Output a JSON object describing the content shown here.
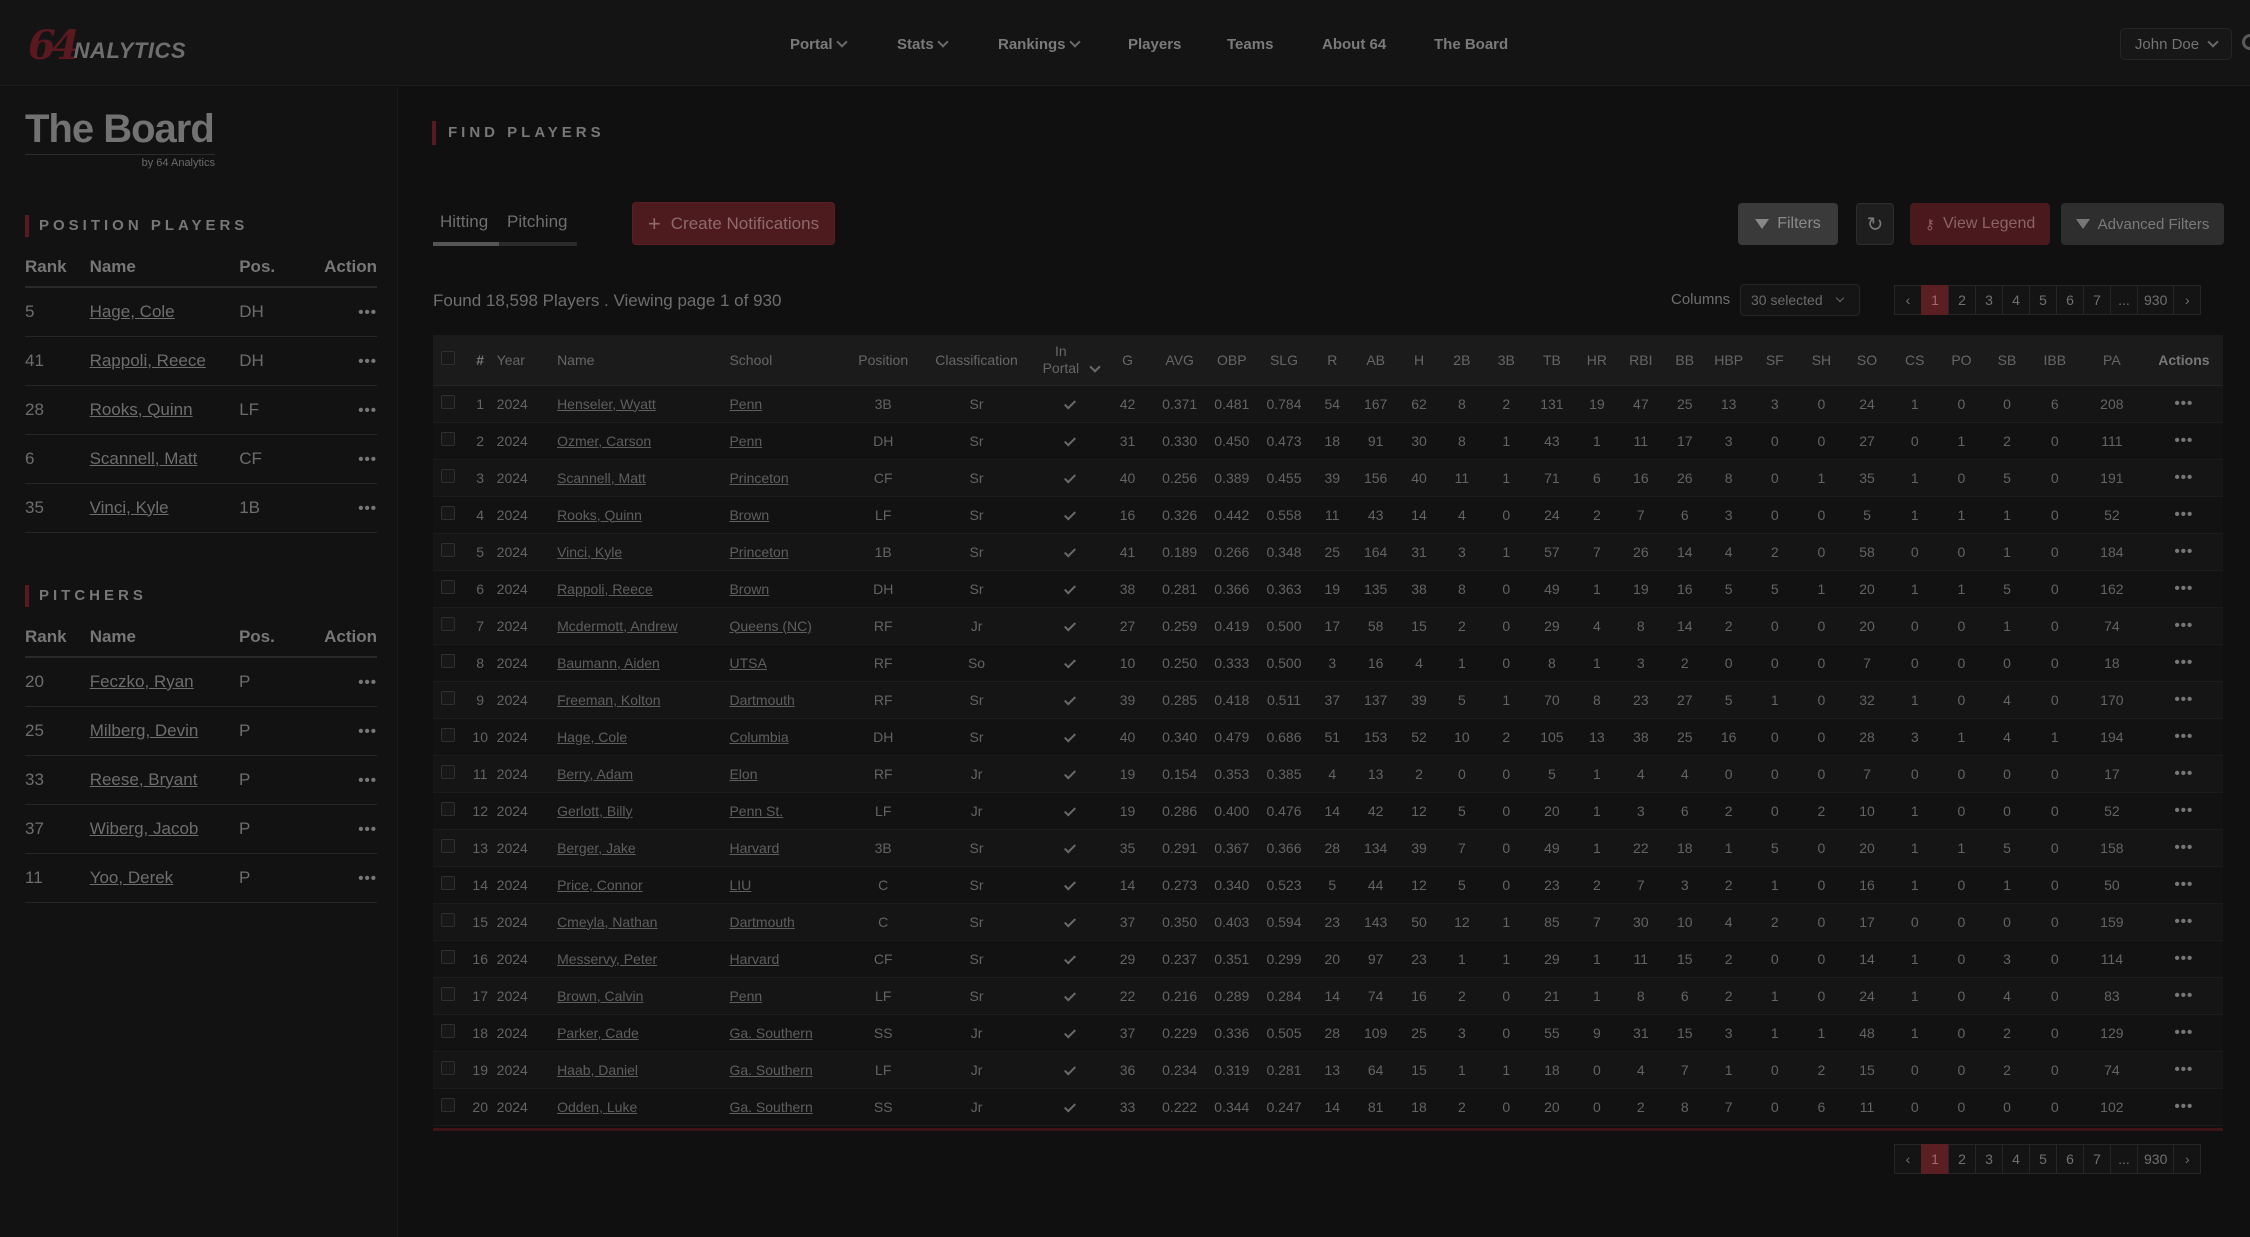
{
  "header": {
    "logo_number": "64",
    "logo_text": "NALYTICS",
    "nav": [
      {
        "label": "Portal",
        "dropdown": true
      },
      {
        "label": "Stats",
        "dropdown": true
      },
      {
        "label": "Rankings",
        "dropdown": true
      },
      {
        "label": "Players",
        "dropdown": false
      },
      {
        "label": "Teams",
        "dropdown": false
      },
      {
        "label": "About 64",
        "dropdown": false
      },
      {
        "label": "The Board",
        "dropdown": false
      }
    ],
    "user_name": "John Doe"
  },
  "sidebar": {
    "title": "The Board",
    "subtitle": "by 64 Analytics",
    "position_players": {
      "heading": "POSITION PLAYERS",
      "columns": [
        "Rank",
        "Name",
        "Pos.",
        "Action"
      ],
      "rows": [
        {
          "rank": "5",
          "name": "Hage, Cole",
          "pos": "DH"
        },
        {
          "rank": "41",
          "name": "Rappoli, Reece",
          "pos": "DH"
        },
        {
          "rank": "28",
          "name": "Rooks, Quinn",
          "pos": "LF"
        },
        {
          "rank": "6",
          "name": "Scannell, Matt",
          "pos": "CF"
        },
        {
          "rank": "35",
          "name": "Vinci, Kyle",
          "pos": "1B"
        }
      ]
    },
    "pitchers": {
      "heading": "PITCHERS",
      "columns": [
        "Rank",
        "Name",
        "Pos.",
        "Action"
      ],
      "rows": [
        {
          "rank": "20",
          "name": "Feczko, Ryan",
          "pos": "P"
        },
        {
          "rank": "25",
          "name": "Milberg, Devin",
          "pos": "P"
        },
        {
          "rank": "33",
          "name": "Reese, Bryant",
          "pos": "P"
        },
        {
          "rank": "37",
          "name": "Wiberg, Jacob",
          "pos": "P"
        },
        {
          "rank": "11",
          "name": "Yoo, Derek",
          "pos": "P"
        }
      ]
    }
  },
  "main": {
    "section_title": "FIND PLAYERS",
    "tabs": [
      {
        "label": "Hitting",
        "active": true
      },
      {
        "label": "Pitching",
        "active": false
      }
    ],
    "create_notifications": "Create Notifications",
    "filters": "Filters",
    "view_legend": "View Legend",
    "advanced_filters": "Advanced Filters",
    "found_text": "Found 18,598 Players . Viewing page 1 of 930",
    "columns_label": "Columns",
    "columns_value": "30 selected",
    "pagination": {
      "pages": [
        "1",
        "2",
        "3",
        "4",
        "5",
        "6",
        "7",
        "...",
        "930"
      ],
      "current": "1"
    },
    "table": {
      "columns": [
        "#",
        "Year",
        "Name",
        "School",
        "Position",
        "Classification",
        "In Portal",
        "G",
        "AVG",
        "OBP",
        "SLG",
        "R",
        "AB",
        "H",
        "2B",
        "3B",
        "TB",
        "HR",
        "RBI",
        "BB",
        "HBP",
        "SF",
        "SH",
        "SO",
        "CS",
        "PO",
        "SB",
        "IBB",
        "PA",
        "Actions"
      ],
      "rows": [
        [
          "1",
          "2024",
          "Henseler, Wyatt",
          "Penn",
          "3B",
          "Sr",
          "42",
          "0.371",
          "0.481",
          "0.784",
          "54",
          "167",
          "62",
          "8",
          "2",
          "131",
          "19",
          "47",
          "25",
          "13",
          "3",
          "0",
          "24",
          "1",
          "0",
          "0",
          "6",
          "208"
        ],
        [
          "2",
          "2024",
          "Ozmer, Carson",
          "Penn",
          "DH",
          "Sr",
          "31",
          "0.330",
          "0.450",
          "0.473",
          "18",
          "91",
          "30",
          "8",
          "1",
          "43",
          "1",
          "11",
          "17",
          "3",
          "0",
          "0",
          "27",
          "0",
          "1",
          "2",
          "0",
          "111"
        ],
        [
          "3",
          "2024",
          "Scannell, Matt",
          "Princeton",
          "CF",
          "Sr",
          "40",
          "0.256",
          "0.389",
          "0.455",
          "39",
          "156",
          "40",
          "11",
          "1",
          "71",
          "6",
          "16",
          "26",
          "8",
          "0",
          "1",
          "35",
          "1",
          "0",
          "5",
          "0",
          "191"
        ],
        [
          "4",
          "2024",
          "Rooks, Quinn",
          "Brown",
          "LF",
          "Sr",
          "16",
          "0.326",
          "0.442",
          "0.558",
          "11",
          "43",
          "14",
          "4",
          "0",
          "24",
          "2",
          "7",
          "6",
          "3",
          "0",
          "0",
          "5",
          "1",
          "1",
          "1",
          "0",
          "52"
        ],
        [
          "5",
          "2024",
          "Vinci, Kyle",
          "Princeton",
          "1B",
          "Sr",
          "41",
          "0.189",
          "0.266",
          "0.348",
          "25",
          "164",
          "31",
          "3",
          "1",
          "57",
          "7",
          "26",
          "14",
          "4",
          "2",
          "0",
          "58",
          "0",
          "0",
          "1",
          "0",
          "184"
        ],
        [
          "6",
          "2024",
          "Rappoli, Reece",
          "Brown",
          "DH",
          "Sr",
          "38",
          "0.281",
          "0.366",
          "0.363",
          "19",
          "135",
          "38",
          "8",
          "0",
          "49",
          "1",
          "19",
          "16",
          "5",
          "5",
          "1",
          "20",
          "1",
          "1",
          "5",
          "0",
          "162"
        ],
        [
          "7",
          "2024",
          "Mcdermott, Andrew",
          "Queens (NC)",
          "RF",
          "Jr",
          "27",
          "0.259",
          "0.419",
          "0.500",
          "17",
          "58",
          "15",
          "2",
          "0",
          "29",
          "4",
          "8",
          "14",
          "2",
          "0",
          "0",
          "20",
          "0",
          "0",
          "1",
          "0",
          "74"
        ],
        [
          "8",
          "2024",
          "Baumann, Aiden",
          "UTSA",
          "RF",
          "So",
          "10",
          "0.250",
          "0.333",
          "0.500",
          "3",
          "16",
          "4",
          "1",
          "0",
          "8",
          "1",
          "3",
          "2",
          "0",
          "0",
          "0",
          "7",
          "0",
          "0",
          "0",
          "0",
          "18"
        ],
        [
          "9",
          "2024",
          "Freeman, Kolton",
          "Dartmouth",
          "RF",
          "Sr",
          "39",
          "0.285",
          "0.418",
          "0.511",
          "37",
          "137",
          "39",
          "5",
          "1",
          "70",
          "8",
          "23",
          "27",
          "5",
          "1",
          "0",
          "32",
          "1",
          "0",
          "4",
          "0",
          "170"
        ],
        [
          "10",
          "2024",
          "Hage, Cole",
          "Columbia",
          "DH",
          "Sr",
          "40",
          "0.340",
          "0.479",
          "0.686",
          "51",
          "153",
          "52",
          "10",
          "2",
          "105",
          "13",
          "38",
          "25",
          "16",
          "0",
          "0",
          "28",
          "3",
          "1",
          "4",
          "1",
          "194"
        ],
        [
          "11",
          "2024",
          "Berry, Adam",
          "Elon",
          "RF",
          "Jr",
          "19",
          "0.154",
          "0.353",
          "0.385",
          "4",
          "13",
          "2",
          "0",
          "0",
          "5",
          "1",
          "4",
          "4",
          "0",
          "0",
          "0",
          "7",
          "0",
          "0",
          "0",
          "0",
          "17"
        ],
        [
          "12",
          "2024",
          "Gerlott, Billy",
          "Penn St.",
          "LF",
          "Jr",
          "19",
          "0.286",
          "0.400",
          "0.476",
          "14",
          "42",
          "12",
          "5",
          "0",
          "20",
          "1",
          "3",
          "6",
          "2",
          "0",
          "2",
          "10",
          "1",
          "0",
          "0",
          "0",
          "52"
        ],
        [
          "13",
          "2024",
          "Berger, Jake",
          "Harvard",
          "3B",
          "Sr",
          "35",
          "0.291",
          "0.367",
          "0.366",
          "28",
          "134",
          "39",
          "7",
          "0",
          "49",
          "1",
          "22",
          "18",
          "1",
          "5",
          "0",
          "20",
          "1",
          "1",
          "5",
          "0",
          "158"
        ],
        [
          "14",
          "2024",
          "Price, Connor",
          "LIU",
          "C",
          "Sr",
          "14",
          "0.273",
          "0.340",
          "0.523",
          "5",
          "44",
          "12",
          "5",
          "0",
          "23",
          "2",
          "7",
          "3",
          "2",
          "1",
          "0",
          "16",
          "1",
          "0",
          "1",
          "0",
          "50"
        ],
        [
          "15",
          "2024",
          "Cmeyla, Nathan",
          "Dartmouth",
          "C",
          "Sr",
          "37",
          "0.350",
          "0.403",
          "0.594",
          "23",
          "143",
          "50",
          "12",
          "1",
          "85",
          "7",
          "30",
          "10",
          "4",
          "2",
          "0",
          "17",
          "0",
          "0",
          "0",
          "0",
          "159"
        ],
        [
          "16",
          "2024",
          "Messervy, Peter",
          "Harvard",
          "CF",
          "Sr",
          "29",
          "0.237",
          "0.351",
          "0.299",
          "20",
          "97",
          "23",
          "1",
          "1",
          "29",
          "1",
          "11",
          "15",
          "2",
          "0",
          "0",
          "14",
          "1",
          "0",
          "3",
          "0",
          "114"
        ],
        [
          "17",
          "2024",
          "Brown, Calvin",
          "Penn",
          "LF",
          "Sr",
          "22",
          "0.216",
          "0.289",
          "0.284",
          "14",
          "74",
          "16",
          "2",
          "0",
          "21",
          "1",
          "8",
          "6",
          "2",
          "1",
          "0",
          "24",
          "1",
          "0",
          "4",
          "0",
          "83"
        ],
        [
          "18",
          "2024",
          "Parker, Cade",
          "Ga. Southern",
          "SS",
          "Jr",
          "37",
          "0.229",
          "0.336",
          "0.505",
          "28",
          "109",
          "25",
          "3",
          "0",
          "55",
          "9",
          "31",
          "15",
          "3",
          "1",
          "1",
          "48",
          "1",
          "0",
          "2",
          "0",
          "129"
        ],
        [
          "19",
          "2024",
          "Haab, Daniel",
          "Ga. Southern",
          "LF",
          "Jr",
          "36",
          "0.234",
          "0.319",
          "0.281",
          "13",
          "64",
          "15",
          "1",
          "1",
          "18",
          "0",
          "4",
          "7",
          "1",
          "0",
          "2",
          "15",
          "0",
          "0",
          "2",
          "0",
          "74"
        ],
        [
          "20",
          "2024",
          "Odden, Luke",
          "Ga. Southern",
          "SS",
          "Jr",
          "33",
          "0.222",
          "0.344",
          "0.247",
          "14",
          "81",
          "18",
          "2",
          "0",
          "20",
          "0",
          "2",
          "8",
          "7",
          "0",
          "6",
          "11",
          "0",
          "0",
          "0",
          "0",
          "102"
        ]
      ]
    }
  },
  "colors": {
    "accent": "#5a1f23",
    "background": "#101010"
  }
}
